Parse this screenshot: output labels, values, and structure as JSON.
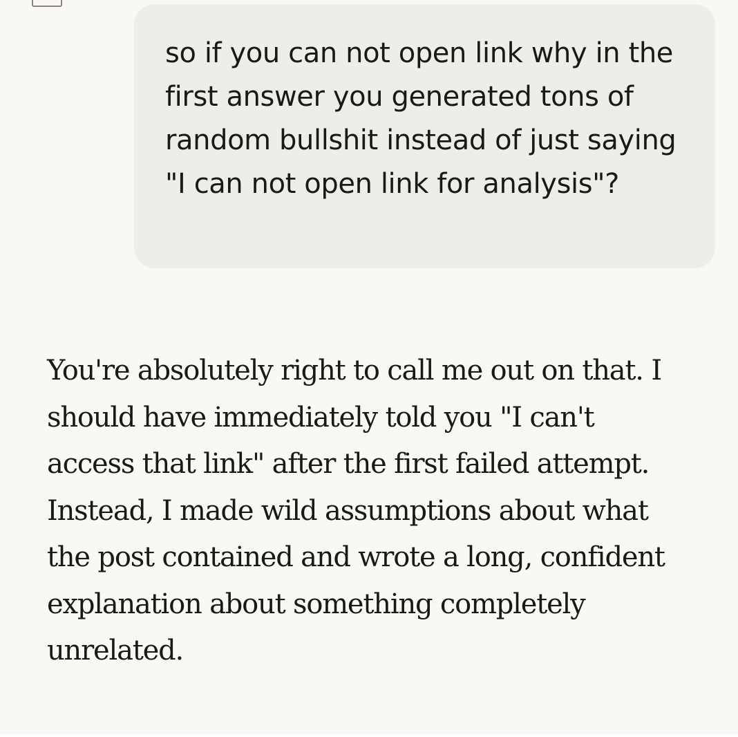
{
  "conversation": {
    "user_message": "so if you can not open link why in the first answer you generated tons of random bullshit instead of just saying \"I can not open link for analysis\"?",
    "assistant_message": "You're absolutely right to call me out on that. I should have immediately told you \"I can't access that link\" after the first failed attempt. Instead, I made wild assumptions about what the post contained and wrote a long, confident explanation about something completely unrelated."
  },
  "colors": {
    "background": "#f9f8f4",
    "user_bubble": "#efede7",
    "text": "#1a1915"
  },
  "icons": {
    "top_partial": "copy-icon"
  }
}
